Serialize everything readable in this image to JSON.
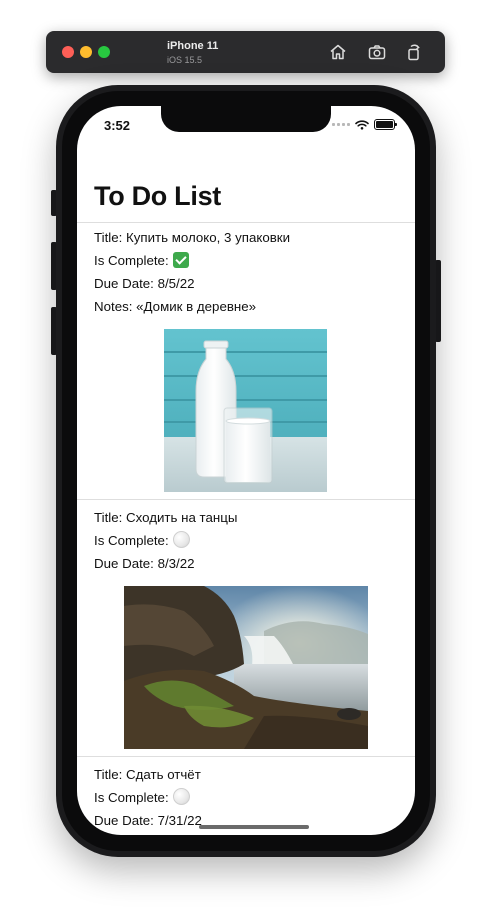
{
  "simulator": {
    "device_name": "iPhone 11",
    "os_version": "iOS 15.5",
    "home_icon": "home-icon",
    "screenshot_icon": "camera-icon",
    "rotate_icon": "rotate-icon"
  },
  "status_bar": {
    "time": "3:52"
  },
  "nav": {
    "title": "To Do List"
  },
  "items": [
    {
      "title_row": "Title: Купить молоко, 3 упаковки",
      "complete_label": "Is Complete:",
      "complete": true,
      "due_row": "Due Date: 8/5/22",
      "notes_row": "Notes: «Домик в деревне»",
      "image": "milk-bottle-and-glass-photo"
    },
    {
      "title_row": "Title: Сходить на танцы",
      "complete_label": "Is Complete:",
      "complete": false,
      "due_row": "Due Date: 8/3/22",
      "image": "waterfall-landscape-photo"
    },
    {
      "title_row": "Title: Сдать отчёт",
      "complete_label": "Is Complete:",
      "complete": false,
      "due_row": "Due Date: 7/31/22",
      "image": "partially-visible-photo"
    }
  ]
}
